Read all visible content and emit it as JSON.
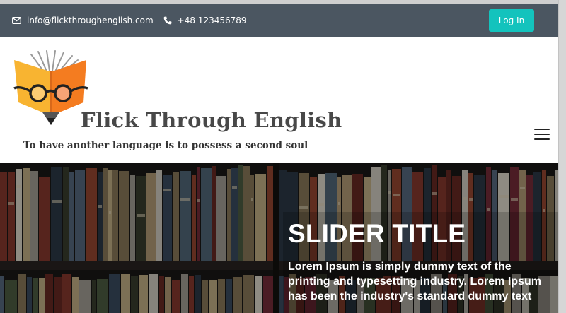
{
  "topbar": {
    "email": "info@flickthroughenglish.com",
    "phone": "+48 123456789",
    "login_label": "Log In",
    "email_icon": "envelope-icon",
    "phone_icon": "phone-icon"
  },
  "header": {
    "brand_title": "Flick Through English",
    "tagline": "To have another language is to possess a second soul",
    "logo_icon": "book-glasses-logo",
    "menu_icon": "hamburger-menu-icon"
  },
  "hero": {
    "title": "SLIDER TITLE",
    "text": "Lorem Ipsum is simply dummy text of the printing and typesetting industry. Lorem Ipsum has been the industry's standard dummy text"
  },
  "colors": {
    "topbar_bg": "#4b5661",
    "login_button": "#13c3bd",
    "logo_orange": "#f47c20",
    "logo_yellow": "#f8b431"
  }
}
